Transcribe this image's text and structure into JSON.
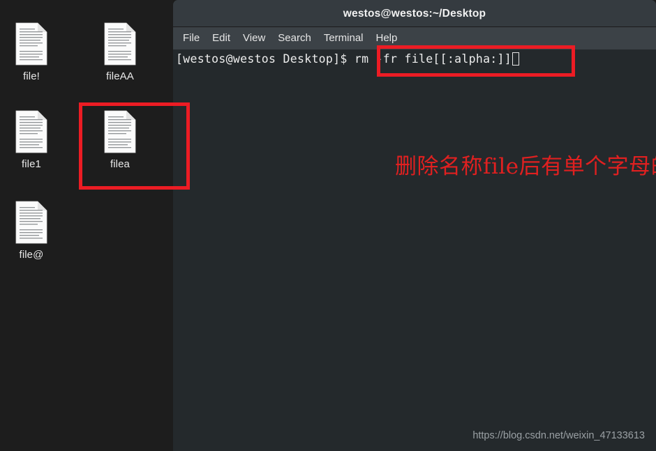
{
  "desktop": {
    "background_color": "#1d1d1d",
    "icons": [
      {
        "label": "file!",
        "icon": "document-icon",
        "col": 0,
        "row": 0
      },
      {
        "label": "fileAA",
        "icon": "document-icon",
        "col": 1,
        "row": 0
      },
      {
        "label": "file1",
        "icon": "document-icon",
        "col": 0,
        "row": 1
      },
      {
        "label": "filea",
        "icon": "document-icon",
        "col": 1,
        "row": 1
      },
      {
        "label": "file@",
        "icon": "document-icon",
        "col": 0,
        "row": 2
      }
    ]
  },
  "terminal": {
    "title": "westos@westos:~/Desktop",
    "titlebar_color": "#353b40",
    "menubar_color": "#3c4247",
    "body_color": "#24292c",
    "menu": [
      {
        "label": "File"
      },
      {
        "label": "Edit"
      },
      {
        "label": "View"
      },
      {
        "label": "Search"
      },
      {
        "label": "Terminal"
      },
      {
        "label": "Help"
      }
    ],
    "prompt": "[westos@westos Desktop]$ ",
    "command": "rm -fr file[[:alpha:]]",
    "cursor": "block-outline-cursor"
  },
  "annotations": {
    "accent_color": "#ec1c24",
    "text_color": "#e02020",
    "note": "删除名称file后有单个字母的文件",
    "highlight_command": "rm -fr file[[:alpha:]]",
    "highlight_icon": "filea"
  },
  "watermark": {
    "text": "https://blog.csdn.net/weixin_47133613"
  }
}
